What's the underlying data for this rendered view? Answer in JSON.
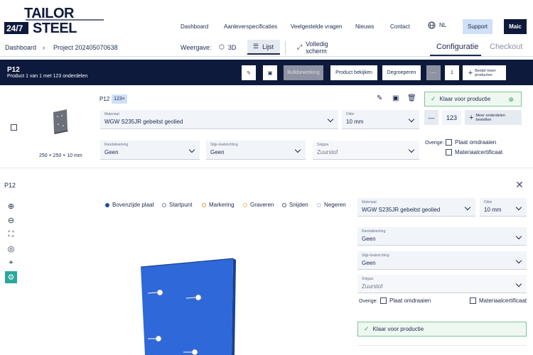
{
  "brand": {
    "logo_top": "TAILOR",
    "logo_bottom": "STEEL",
    "logo_badge": "24/7"
  },
  "nav": {
    "items": [
      "Dashboard",
      "Aanleverspecificaties",
      "Veelgestelde vragen",
      "Nieuws",
      "Contact"
    ],
    "language": "NL",
    "support": "Support",
    "user": "Maic"
  },
  "breadcrumb": {
    "root": "Dashboard",
    "project": "Project 202405070638"
  },
  "view": {
    "label": "Weergave:",
    "option_3d": "3D",
    "option_list": "Lijst",
    "fullscreen": "Volledig scherm"
  },
  "tabs": {
    "configuratie": "Configuratie",
    "checkout": "Checkout"
  },
  "header": {
    "title": "P12",
    "subtitle": "Product 1 van 1 met 123 onderdelen",
    "bulk": "Bulkbewerking",
    "view_product": "Product bekijken",
    "ungroup": "Degroeperen",
    "qty": "1",
    "order_more": "Bestel meer producten"
  },
  "part": {
    "name": "P12",
    "qty_badge": "123×",
    "dims": "250 × 250 × 10 mm",
    "materiaal_label": "Materiaal",
    "materiaal_value": "WGW S235JR gebeitst geolied",
    "dikte_label": "Dikte",
    "dikte_value": "10 mm",
    "rand_label": "Randafwerking",
    "rand_value": "Geen",
    "slijp_label": "Slijp-/walsrichting",
    "slijp_value": "Geen",
    "snijgas_label": "Snijgas",
    "snijgas_value": "Zuurstof",
    "status": "Klaar voor productie",
    "qty": "123",
    "order_more": "Meer onderdelen bestellen",
    "overige_label": "Overige:",
    "plaat_omdraaien": "Plaat omdraaien",
    "materiaalcertificaat": "Materiaalcertificaat"
  },
  "detail": {
    "title": "P12",
    "legend": [
      {
        "label": "Bovenzijde plaat",
        "color": "#1c4aa8",
        "filled": true
      },
      {
        "label": "Startpunt",
        "color": "#6d7bbd",
        "filled": false
      },
      {
        "label": "Markering",
        "color": "#e6944a",
        "filled": false
      },
      {
        "label": "Graveren",
        "color": "#e8c25a",
        "filled": false
      },
      {
        "label": "Snijden",
        "color": "#4a5570",
        "filled": false
      },
      {
        "label": "Negeren",
        "color": "#c0c6d2",
        "filled": false
      }
    ],
    "materiaal_label": "Materiaal",
    "materiaal_value": "WGW S235JR gebeitst geolied",
    "dikte_label": "Dikte",
    "dikte_value": "10 mm",
    "rand_label": "Randafwerking",
    "rand_value": "Geen",
    "slijp_label": "Slijp-/walsrichting",
    "slijp_value": "Geen",
    "snijgas_label": "Snijgas",
    "snijgas_value": "Zuurstof",
    "overige_label": "Overige:",
    "plaat_omdraaien": "Plaat omdraaien",
    "materiaalcertificaat": "Materiaalcertificaat",
    "status": "Klaar voor productie"
  },
  "colors": {
    "navy": "#0e1a3c",
    "accent_blue": "#cfe0f7",
    "teal": "#2aa79b",
    "ok_green": "#2e9f5b",
    "part_blue": "#2f68d8"
  }
}
